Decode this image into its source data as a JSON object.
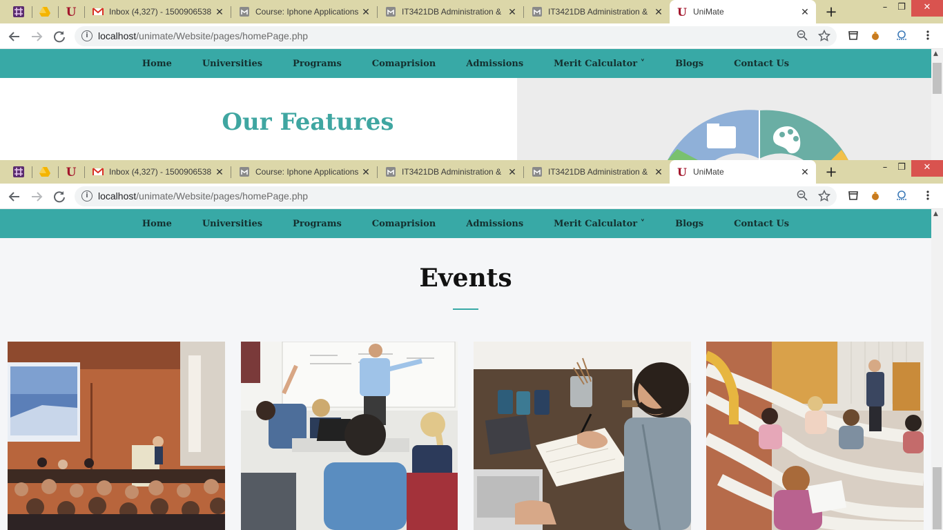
{
  "browser": {
    "tabs": [
      {
        "title": "Inbox (4,327) - 1500906538",
        "close": "✕"
      },
      {
        "title": "Course: Iphone Applications",
        "close": "✕"
      },
      {
        "title": "IT3421DB Administration &",
        "close": "✕"
      },
      {
        "title": "IT3421DB Administration &",
        "close": "✕"
      },
      {
        "title": "UniMate",
        "close": "✕"
      }
    ],
    "new_tab": "+",
    "window_controls": {
      "minimize": "–",
      "restore": "❐",
      "close": "✕"
    },
    "url_host": "localhost",
    "url_path": "/unimate/Website/pages/homePage.php"
  },
  "nav": {
    "items": [
      "Home",
      "Universities",
      "Programs",
      "Comaprision",
      "Admissions",
      "Merit Calculator ˅",
      "Blogs",
      "Contact Us"
    ]
  },
  "features": {
    "title": "Our Features"
  },
  "events": {
    "title": "Events"
  },
  "icons": {
    "back": "arrow-left-icon",
    "forward": "arrow-right-icon",
    "reload": "reload-icon",
    "info": "info-icon",
    "zoom": "zoom-icon",
    "bookmark": "star-icon"
  },
  "colors": {
    "accent": "#38a9a6",
    "tabbar": "#dcd7a9",
    "close_button": "#d9534f",
    "feature_title": "#3fa6a1"
  }
}
